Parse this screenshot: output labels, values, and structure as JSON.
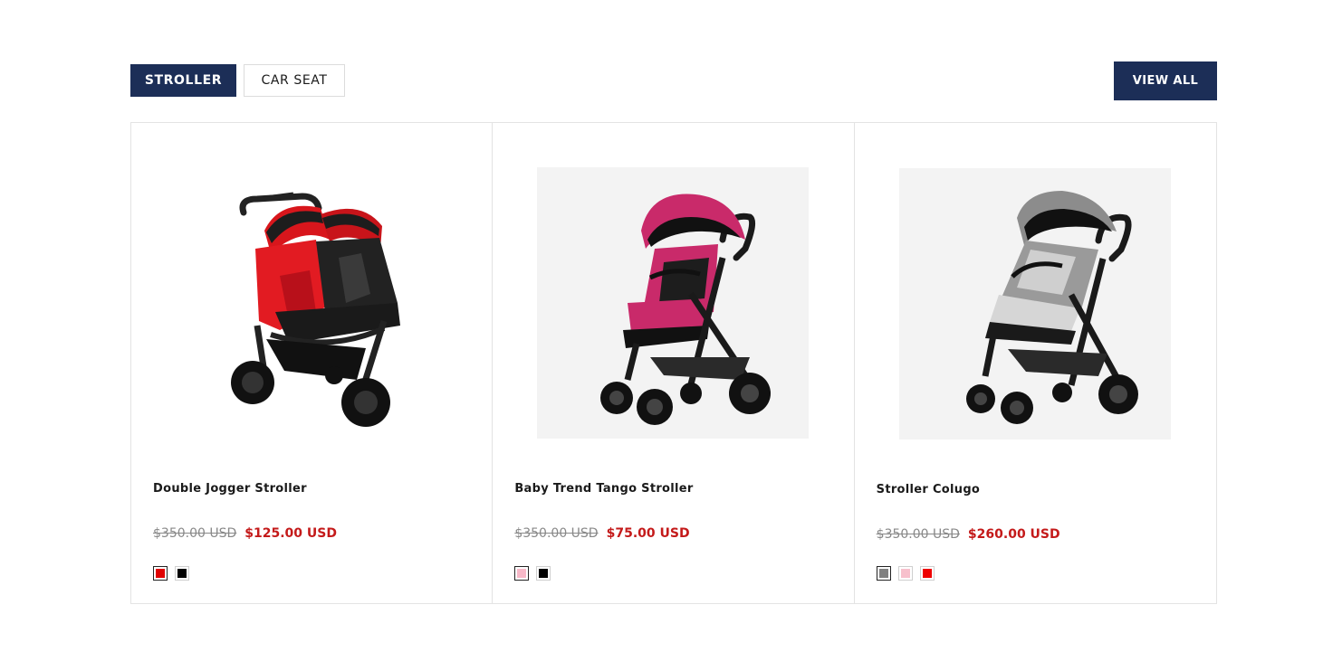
{
  "tabs": [
    {
      "label": "STROLLER",
      "active": true
    },
    {
      "label": "CAR SEAT",
      "active": false
    }
  ],
  "view_all_label": "VIEW ALL",
  "colors": {
    "accent": "#1c2e57",
    "sale_price": "#c41a1a"
  },
  "products": [
    {
      "title": "Double Jogger Stroller",
      "compare_price": "$350.00 USD",
      "price": "$125.00 USD",
      "image_icon": "twin-jogger-stroller-red",
      "swatches": [
        "#e00000",
        "#000000"
      ]
    },
    {
      "title": "Baby Trend Tango Stroller",
      "compare_price": "$350.00 USD",
      "price": "$75.00 USD",
      "image_icon": "stroller-pink",
      "swatches": [
        "#f7b8c8",
        "#000000"
      ]
    },
    {
      "title": "Stroller Colugo",
      "compare_price": "$350.00 USD",
      "price": "$260.00 USD",
      "image_icon": "stroller-grey",
      "swatches": [
        "#808080",
        "#f7c0cc",
        "#ee0000"
      ]
    }
  ]
}
